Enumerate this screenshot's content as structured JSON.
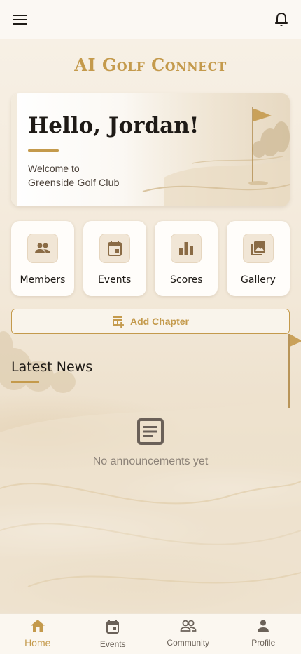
{
  "app": {
    "title": "AI Golf Connect"
  },
  "topbar": {
    "menu_icon": "menu-icon",
    "notification_icon": "bell-icon"
  },
  "hero": {
    "greeting": "Hello, Jordan!",
    "welcome": "Welcome to",
    "club_name": "Greenside Golf Club"
  },
  "tiles": [
    {
      "label": "Members",
      "icon": "people-icon"
    },
    {
      "label": "Events",
      "icon": "calendar-icon"
    },
    {
      "label": "Scores",
      "icon": "bar-chart-icon"
    },
    {
      "label": "Gallery",
      "icon": "gallery-icon"
    }
  ],
  "add_chapter": {
    "label": "Add Chapter",
    "icon": "add-business-icon"
  },
  "news": {
    "title": "Latest News",
    "empty_text": "No announcements yet",
    "empty_icon": "article-icon"
  },
  "bottom_nav": [
    {
      "label": "Home",
      "icon": "home-icon",
      "active": true
    },
    {
      "label": "Events",
      "icon": "calendar-icon",
      "active": false
    },
    {
      "label": "Community",
      "icon": "community-icon",
      "active": false
    },
    {
      "label": "Profile",
      "icon": "person-icon",
      "active": false
    }
  ],
  "colors": {
    "accent": "#c49a4c",
    "background": "#f5ede1",
    "tile_icon_bg": "#f1e6d6",
    "icon_dark": "#5f4f3f",
    "muted_text": "#8c8278"
  }
}
